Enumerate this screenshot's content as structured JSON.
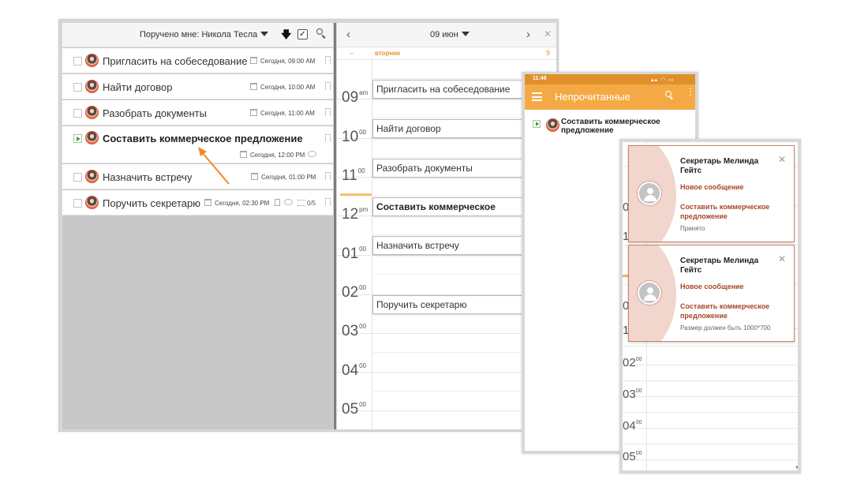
{
  "tasks": {
    "header_title": "Поручено мне: Никола Тесла",
    "icons": [
      "arrow-down-icon",
      "check-icon",
      "search-icon"
    ],
    "items": [
      {
        "title": "Пригласить на собеседование",
        "date": "Сегодня, 09:00 AM"
      },
      {
        "title": "Найти договор",
        "date": "Сегодня, 10:00 AM"
      },
      {
        "title": "Разобрать документы",
        "date": "Сегодня, 11:00 AM"
      },
      {
        "title": "Составить коммерческое предложение",
        "date": "Сегодня, 12:00 PM",
        "active": true
      },
      {
        "title": "Назначить встречу",
        "date": "Сегодня, 01:00 PM"
      },
      {
        "title": "Поручить секретарю",
        "date": "Сегодня, 02:30 PM",
        "subtasks": "0/5"
      }
    ]
  },
  "calendar": {
    "date": "09 июн",
    "weekday": "вторник",
    "day_number": "9",
    "top_dash": "–",
    "hours": [
      {
        "h": "09",
        "s": "am"
      },
      {
        "h": "10",
        "s": "00"
      },
      {
        "h": "11",
        "s": "00"
      },
      {
        "h": "12",
        "s": "pm"
      },
      {
        "h": "01",
        "s": "00"
      },
      {
        "h": "02",
        "s": "00"
      },
      {
        "h": "03",
        "s": "00"
      },
      {
        "h": "04",
        "s": "00"
      },
      {
        "h": "05",
        "s": "00"
      }
    ],
    "events": [
      "Пригласить на собеседование",
      "Найти договор",
      "Разобрать документы",
      "Составить коммерческое",
      "Назначить встречу",
      "Поручить секретарю"
    ]
  },
  "phone": {
    "status_time": "11:49",
    "status_icons": "▴▴ ◠ ▭",
    "title": "Непрочитанные",
    "item": "Составить коммерческое предложение",
    "accent": "#f5a944"
  },
  "notifications": {
    "hours": [
      {
        "h": "0",
        "s": ""
      },
      {
        "h": "1",
        "s": ""
      },
      {
        "h": "0",
        "s": ""
      },
      {
        "h": "1",
        "s": ""
      },
      {
        "h": "02",
        "s": "00"
      },
      {
        "h": "03",
        "s": "00"
      },
      {
        "h": "04",
        "s": "00"
      },
      {
        "h": "05",
        "s": "00"
      }
    ],
    "cards": [
      {
        "from": "Секретарь Мелинда Гейтс",
        "kind": "Новое сообщение",
        "subject": "Составить коммерческое предложение",
        "note": "Принято"
      },
      {
        "from": "Секретарь Мелинда Гейтс",
        "kind": "Новое сообщение",
        "subject": "Составить коммерческое предложение",
        "note": "Размер должен быть 1000*700"
      }
    ]
  }
}
